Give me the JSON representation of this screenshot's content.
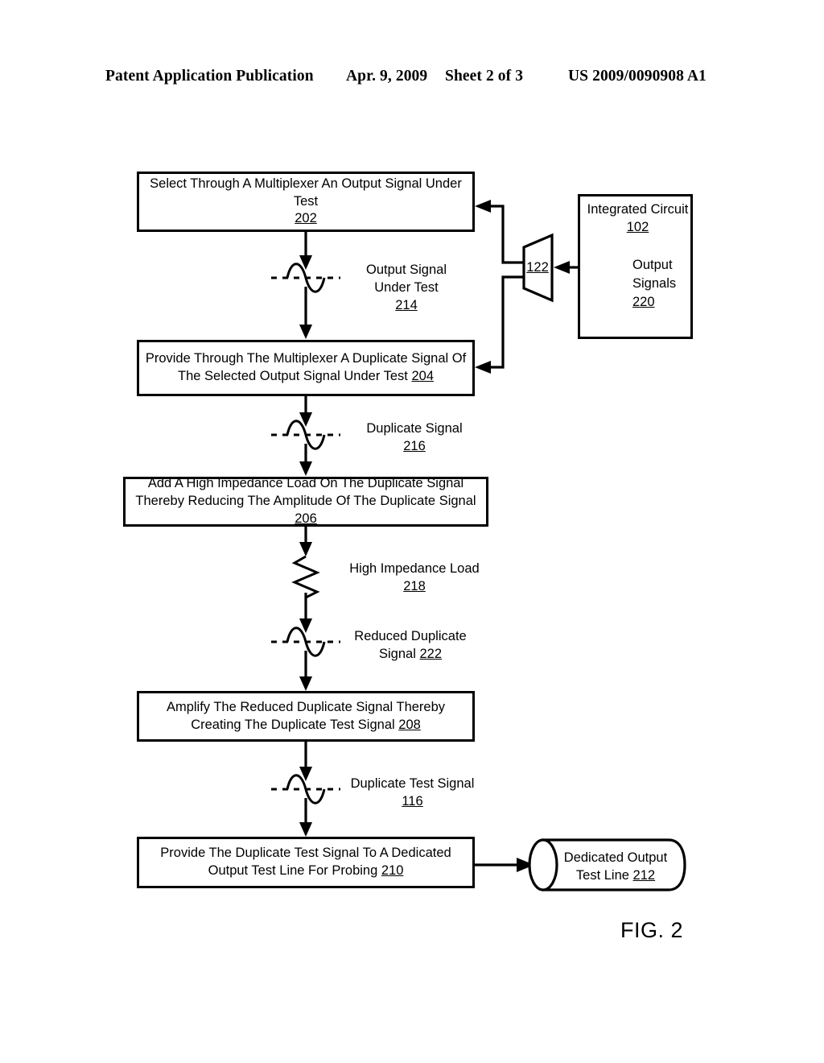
{
  "header": {
    "publication": "Patent Application Publication",
    "date": "Apr. 9, 2009",
    "sheet": "Sheet 2 of 3",
    "patent_number": "US 2009/0090908 A1"
  },
  "figure": {
    "caption": "FIG. 2",
    "boxes": [
      {
        "id": "202",
        "text": "Select Through A Multiplexer An Output Signal Under Test",
        "ref": "202",
        "ref_inline": false
      },
      {
        "id": "204",
        "text": "Provide Through The Multiplexer A Duplicate Signal Of The Selected Output Signal Under Test",
        "ref": "204",
        "ref_inline": true
      },
      {
        "id": "206",
        "text": "Add A High Impedance Load On The Duplicate Signal Thereby Reducing The Amplitude Of The Duplicate Signal",
        "ref": "206",
        "ref_inline": true
      },
      {
        "id": "208",
        "text": "Amplify The Reduced Duplicate Signal Thereby Creating The Duplicate Test Signal",
        "ref": "208",
        "ref_inline": true
      },
      {
        "id": "210",
        "text": "Provide The Duplicate Test Signal To A Dedicated Output Test Line For Probing",
        "ref": "210",
        "ref_inline": true
      }
    ],
    "integrated_circuit": {
      "label": "Integrated Circuit",
      "ref": "102"
    },
    "multiplexer": {
      "ref": "122"
    },
    "output_signals": {
      "line1": "Output",
      "line2": "Signals",
      "ref": "220"
    },
    "signals": [
      {
        "id": "214",
        "line1": "Output Signal",
        "line2": "Under Test",
        "ref": "214",
        "ref_inline": false
      },
      {
        "id": "216",
        "line1": "Duplicate Signal",
        "line2": "",
        "ref": "216",
        "ref_inline": false
      },
      {
        "id": "218",
        "line1": "High Impedance Load",
        "line2": "",
        "ref": "218",
        "ref_inline": false
      },
      {
        "id": "222",
        "line1": "Reduced Duplicate",
        "line2": "Signal",
        "ref": "222",
        "ref_inline": true
      },
      {
        "id": "116",
        "line1": "Duplicate Test Signal",
        "line2": "",
        "ref": "116",
        "ref_inline": false
      }
    ],
    "cylinder": {
      "line1": "Dedicated Output",
      "line2": "Test Line",
      "ref": "212"
    }
  },
  "colors": {
    "ink": "#000000",
    "paper": "#ffffff"
  }
}
